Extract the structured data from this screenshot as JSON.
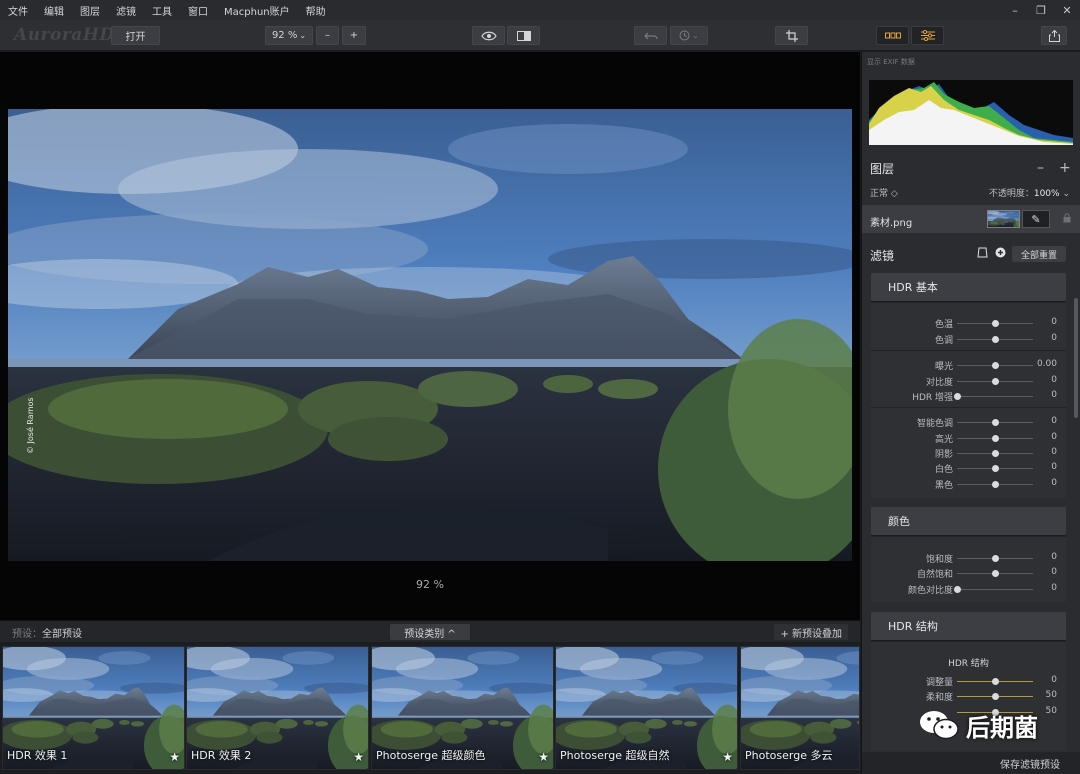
{
  "menu": [
    "文件",
    "编辑",
    "图层",
    "滤镜",
    "工具",
    "窗口",
    "Macphun账户",
    "帮助"
  ],
  "window_controls": [
    "–",
    "❐",
    "✕"
  ],
  "toolbar": {
    "logo": "AuroraHDR",
    "open_label": "打开",
    "zoom_value": "92 %",
    "zoom_minus": "–",
    "zoom_plus": "+"
  },
  "canvas": {
    "zoom_readout": "92 %",
    "credit": "© José Ramos"
  },
  "presets": {
    "label_prefix": "预设：",
    "label_value": "全部预设",
    "category_button": "预设类别 ^",
    "add_button": "+ 新预设叠加",
    "items": [
      {
        "name": "HDR 效果 1",
        "star": "★"
      },
      {
        "name": "HDR 效果 2",
        "star": "★"
      },
      {
        "name": "Photoserge 超级颜色",
        "star": "★"
      },
      {
        "name": "Photoserge 超级自然",
        "star": "★"
      },
      {
        "name": "Photoserge 多云",
        "star": ""
      }
    ]
  },
  "panel": {
    "exif_label": "显示 EXIF 数据",
    "layers": {
      "title": "图层",
      "minus": "–",
      "plus": "+",
      "blend_mode": "正常 ◇",
      "opacity_label": "不透明度：",
      "opacity_value": "100%",
      "layer_name": "素材.png",
      "brush": "✎",
      "lock": "🔒"
    },
    "filters": {
      "title": "滤镜",
      "reset_all": "全部重置",
      "groups": [
        {
          "header": "HDR 基本",
          "rows": [
            {
              "label": "色温",
              "value": "0",
              "pos": 0.5
            },
            {
              "label": "色调",
              "value": "0",
              "pos": 0.5
            },
            {
              "label": "曝光",
              "value": "0.00",
              "pos": 0.5
            },
            {
              "label": "对比度",
              "value": "0",
              "pos": 0.5
            },
            {
              "label": "HDR 增强",
              "value": "0",
              "pos": 0.0
            },
            {
              "label": "智能色调",
              "value": "0",
              "pos": 0.5
            },
            {
              "label": "高光",
              "value": "0",
              "pos": 0.5
            },
            {
              "label": "阴影",
              "value": "0",
              "pos": 0.5
            },
            {
              "label": "白色",
              "value": "0",
              "pos": 0.5
            },
            {
              "label": "黑色",
              "value": "0",
              "pos": 0.5
            }
          ]
        },
        {
          "header": "颜色",
          "rows": [
            {
              "label": "饱和度",
              "value": "0",
              "pos": 0.5
            },
            {
              "label": "自然饱和",
              "value": "0",
              "pos": 0.5
            },
            {
              "label": "颜色对比度",
              "value": "0",
              "pos": 0.0
            }
          ]
        },
        {
          "header": "HDR 结构",
          "subtitle": "HDR 结构",
          "rows": [
            {
              "label": "调整量",
              "value": "0",
              "pos": 0.5
            },
            {
              "label": "柔和度",
              "value": "50",
              "pos": 0.5
            },
            {
              "label": "",
              "value": "50",
              "pos": 0.5
            }
          ]
        }
      ]
    },
    "save_preset": "保存滤镜预设"
  },
  "watermark": {
    "text": "后期菌"
  },
  "colors": {
    "accent": "#e2a23a",
    "panel": "#2b2c30",
    "header": "#3c3e43"
  }
}
